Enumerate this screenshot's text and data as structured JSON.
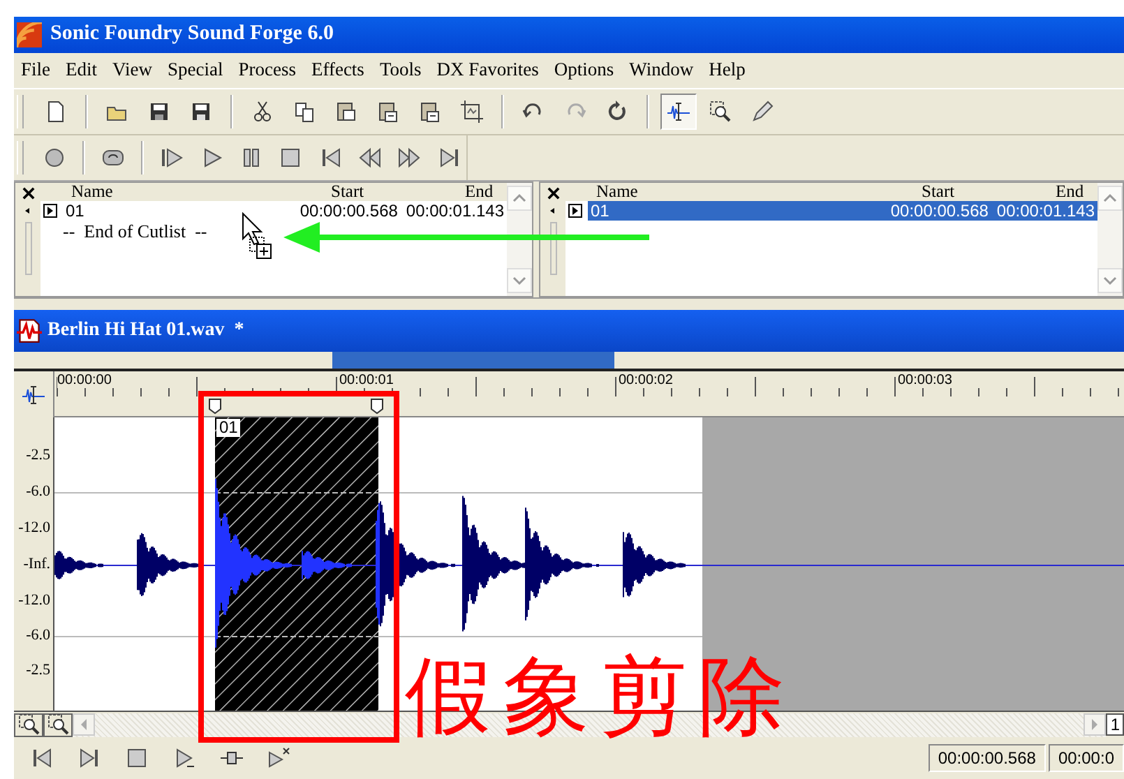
{
  "window": {
    "title": "Sonic Foundry Sound Forge 6.0"
  },
  "menu": [
    "File",
    "Edit",
    "View",
    "Special",
    "Process",
    "Effects",
    "Tools",
    "DX Favorites",
    "Options",
    "Window",
    "Help"
  ],
  "tools": [
    {
      "selected": true
    },
    {
      "selected": false
    },
    {
      "selected": false
    }
  ],
  "cutlists": [
    {
      "columns": [
        "Name",
        "Start",
        "End"
      ],
      "rows": [
        {
          "name": "01",
          "start": "00:00:00.568",
          "end": "00:00:01.143",
          "selected": false
        }
      ],
      "footer": "--  End of Cutlist  --"
    },
    {
      "columns": [
        "Name",
        "Start",
        "End"
      ],
      "rows": [
        {
          "name": "01",
          "start": "00:00:00.568",
          "end": "00:00:01.143",
          "selected": true
        }
      ]
    }
  ],
  "document": {
    "title": "Berlin Hi Hat 01.wav  *",
    "ruler": [
      "00:00:00",
      "00:00:01",
      "00:00:02",
      "00:00:03"
    ],
    "region": {
      "label": "01"
    },
    "db_scale": [
      "-2.5",
      "-6.0",
      "-12.0",
      "-Inf.",
      "-12.0",
      "-6.0",
      "-2.5"
    ]
  },
  "scroll_field": "1",
  "status": [
    "00:00:00.568",
    "00:00:0"
  ],
  "annotation": {
    "text": "假象剪除"
  }
}
